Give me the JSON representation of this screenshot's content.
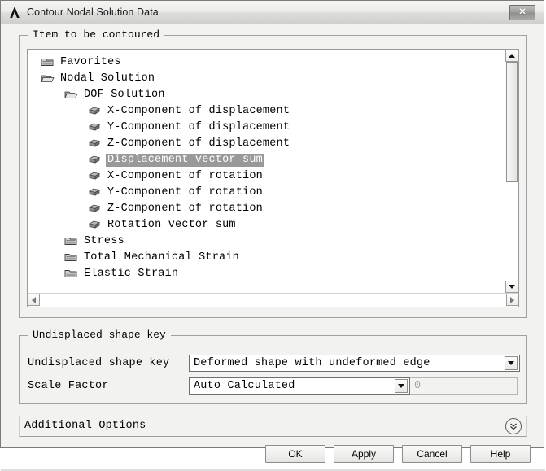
{
  "window": {
    "title": "Contour Nodal Solution Data",
    "logo_icon": "ansys-lambda-logo",
    "close_label": "✕"
  },
  "contour_group": {
    "legend": "Item to be contoured",
    "tree": {
      "scrollbar": {
        "up_icon": "scroll-up-arrow-icon",
        "down_icon": "scroll-down-arrow-icon",
        "left_icon": "scroll-left-arrow-icon",
        "right_icon": "scroll-right-arrow-icon"
      },
      "items": [
        {
          "label": "Favorites",
          "level": 0,
          "icon": "folder-closed-icon",
          "selected": false
        },
        {
          "label": "Nodal Solution",
          "level": 0,
          "icon": "folder-open-icon",
          "selected": false
        },
        {
          "label": "DOF Solution",
          "level": 1,
          "icon": "folder-open-icon",
          "selected": false
        },
        {
          "label": "X-Component of displacement",
          "level": 2,
          "icon": "cube-icon",
          "selected": false
        },
        {
          "label": "Y-Component of displacement",
          "level": 2,
          "icon": "cube-icon",
          "selected": false
        },
        {
          "label": "Z-Component of displacement",
          "level": 2,
          "icon": "cube-icon",
          "selected": false
        },
        {
          "label": "Displacement vector sum",
          "level": 2,
          "icon": "cube-icon",
          "selected": true
        },
        {
          "label": "X-Component of rotation",
          "level": 2,
          "icon": "cube-icon",
          "selected": false
        },
        {
          "label": "Y-Component of rotation",
          "level": 2,
          "icon": "cube-icon",
          "selected": false
        },
        {
          "label": "Z-Component of rotation",
          "level": 2,
          "icon": "cube-icon",
          "selected": false
        },
        {
          "label": "Rotation vector sum",
          "level": 2,
          "icon": "cube-icon",
          "selected": false
        },
        {
          "label": "Stress",
          "level": 1,
          "icon": "folder-closed-icon",
          "selected": false
        },
        {
          "label": "Total Mechanical Strain",
          "level": 1,
          "icon": "folder-closed-icon",
          "selected": false
        },
        {
          "label": "Elastic Strain",
          "level": 1,
          "icon": "folder-closed-icon",
          "selected": false
        }
      ]
    }
  },
  "shape_key_group": {
    "legend": "Undisplaced shape key",
    "shape_key": {
      "label": "Undisplaced shape key",
      "value": "Deformed shape with undeformed edge",
      "arrow_icon": "dropdown-arrow-icon"
    },
    "scale_factor": {
      "label": "Scale Factor",
      "value": "Auto Calculated",
      "arrow_icon": "dropdown-arrow-icon",
      "numeric_value": "0"
    }
  },
  "additional_options": {
    "label": "Additional Options",
    "expand_icon": "double-chevron-down-icon"
  },
  "buttons": {
    "ok": "OK",
    "apply": "Apply",
    "cancel": "Cancel",
    "help": "Help"
  },
  "colors": {
    "selection": "#999999",
    "dialog_bg": "#f2f2f0",
    "tree_bg": "#ffffff"
  }
}
